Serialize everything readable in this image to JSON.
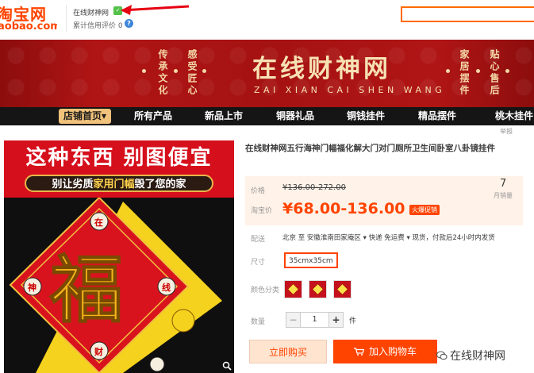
{
  "header": {
    "logo_main": "淘宝网",
    "logo_sub": "aobao.com",
    "shop_name": "在线财神网",
    "rating_label": "累计信用评价",
    "rating_value": "0",
    "rating_icon": "info-icon",
    "badge_icon": "verified-icon"
  },
  "banner": {
    "title": "在线财神网",
    "pinyin": "ZAI  XIAN  CAI  SHEN  WANG",
    "left_phrase_1": "传承文化",
    "left_phrase_2": "感受匠心",
    "right_phrase_1": "家居摆件",
    "right_phrase_2": "贴心售后"
  },
  "nav": {
    "items": [
      {
        "label": "店铺首页▾",
        "active": true
      },
      {
        "label": "所有产品"
      },
      {
        "label": "新品上市"
      },
      {
        "label": "铜器礼品"
      },
      {
        "label": "铜钱挂件"
      },
      {
        "label": "精品摆件"
      },
      {
        "label": "桃木挂件"
      }
    ]
  },
  "report_label": "举报",
  "image": {
    "headline": "这种东西  别图便宜",
    "subline_prefix": "别让劣质",
    "subline_highlight": "家用门幅",
    "subline_suffix": "毁了您的家",
    "fu_char": "福",
    "corner_chars": [
      "在",
      "线",
      "财",
      "神"
    ]
  },
  "product": {
    "title": "在线财神网五行海神门幅福化解大门对门厕所卫生间卧室八卦镜挂件",
    "price_label": "价格",
    "old_price": "¥136.00-272.00",
    "promo_label": "淘宝价",
    "price": "¥68.00-136.00",
    "promo_tag": "火爆促销",
    "sales_count": "7",
    "sales_label": "月销量",
    "shipping_label": "配送",
    "shipping_text": "北京 至  安徽淮南田家庵区 ▾   快递 免运费 ▾   现货，付款后24小时内发货",
    "size_label": "尺寸",
    "size_value": "35cmx35cm",
    "color_label": "颜色分类",
    "quantity_label": "数量",
    "quantity_minus": "−",
    "quantity_value": "1",
    "quantity_plus": "+",
    "quantity_unit": "件",
    "buy_now": "立即购买",
    "add_cart": "加入购物车",
    "cart_icon": "cart-icon"
  },
  "watermark": "在线财神网",
  "colors": {
    "accent": "#ff4400",
    "banner_red": "#a51212",
    "nav_bg": "#151515",
    "gold": "#f1c27b"
  }
}
